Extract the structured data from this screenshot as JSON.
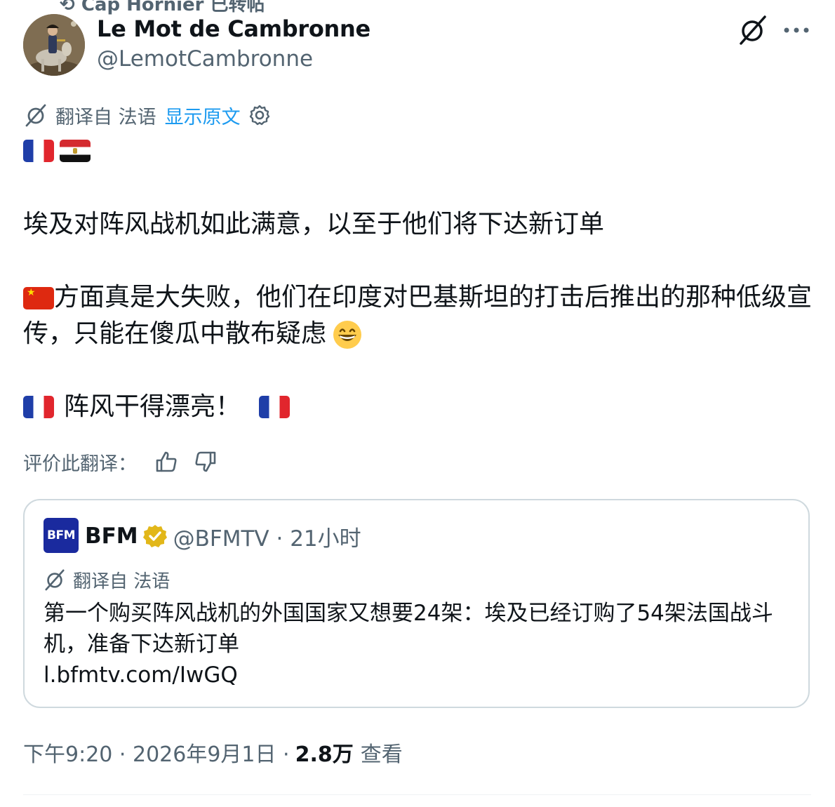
{
  "repost": {
    "text": "Cap Hornier  已转帖"
  },
  "author": {
    "display_name": "Le Mot de Cambronne",
    "handle": "@LemotCambronne"
  },
  "translation": {
    "label": "翻译自 法语",
    "show_original": "显示原文"
  },
  "tweet": {
    "line1": "埃及对阵风战机如此满意，以至于他们将下达新订单",
    "line2": "方面真是大失败，他们在印度对巴基斯坦的打击后推出的那种低级宣传，只能在傻瓜中散布疑虑",
    "line3": "阵风干得漂亮！"
  },
  "rate": {
    "label": "评价此翻译："
  },
  "quote": {
    "logo_text": "BFM",
    "name": "BFM",
    "handle_time": "@BFMTV · 21小时",
    "translation_label": "翻译自 法语",
    "text": "第一个购买阵风战机的外国国家又想要24架：埃及已经订购了54架法国战斗机，准备下达新订单",
    "link": "l.bfmtv.com/IwGQ"
  },
  "footer": {
    "time_date": "下午9:20 · 2026年9月1日 · ",
    "views": "2.8万",
    "views_label": "查看"
  },
  "colors": {
    "text": "#0f1419",
    "secondary": "#536471",
    "link": "#1d9bf0",
    "border": "#cfd9de",
    "bfm_blue": "#1a2a9e",
    "verified_gold": "#e2b719"
  },
  "icons": [
    "translate-icon",
    "more-icon",
    "gear-icon",
    "thumbs-up-icon",
    "thumbs-down-icon",
    "verified-badge-icon",
    "grinning-face-emoji"
  ]
}
